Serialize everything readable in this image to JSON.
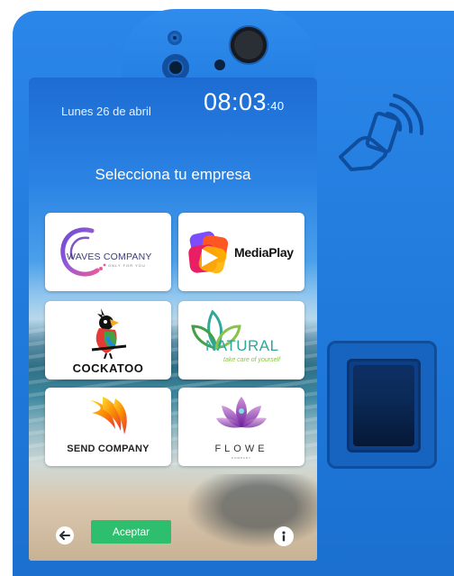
{
  "header": {
    "date": "Lunes 26 de abril",
    "time_hm": "08:03",
    "time_s": ":40"
  },
  "screen": {
    "title": "Selecciona tu empresa"
  },
  "companies": [
    {
      "name": "WAVES COMPANY",
      "tagline": "ONLY FOR YOU"
    },
    {
      "name_a": "Media",
      "name_b": "Play"
    },
    {
      "name": "COCKATOO"
    },
    {
      "name": "NATURAL",
      "tagline": "take care of yourself"
    },
    {
      "name": "SEND COMPANY"
    },
    {
      "name": "FLOWE",
      "tagline": "COMPANY"
    }
  ],
  "footer": {
    "accept_label": "Aceptar",
    "back_icon": "back-arrow-icon",
    "info_icon": "info-icon"
  },
  "colors": {
    "device_blue": "#2a86e8",
    "accept_green": "#2dbf6d",
    "card_bg": "#ffffff"
  }
}
